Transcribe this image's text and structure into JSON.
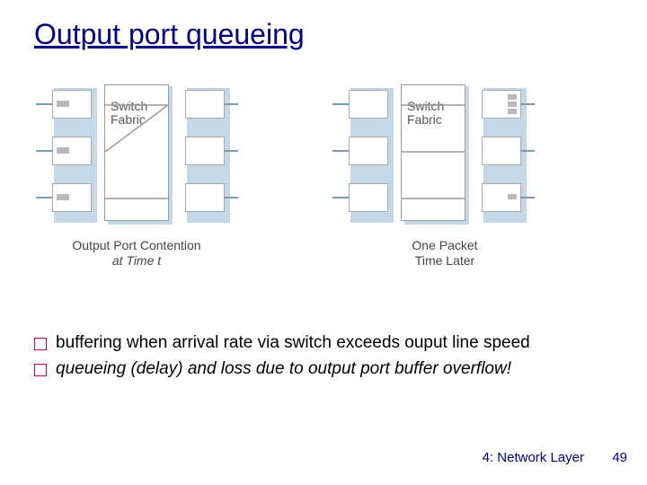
{
  "title": "Output port queueing",
  "diagram": {
    "fabric_label": "Switch\nFabric",
    "caption_left_line1": "Output Port Contention",
    "caption_left_line2": "at Time t",
    "caption_right_line1": "One Packet",
    "caption_right_line2": "Time Later"
  },
  "bullets": [
    "buffering when arrival rate via switch exceeds ouput line speed",
    "queueing (delay) and loss due to output port buffer overflow!"
  ],
  "footer": "4: Network Layer",
  "page": "49"
}
